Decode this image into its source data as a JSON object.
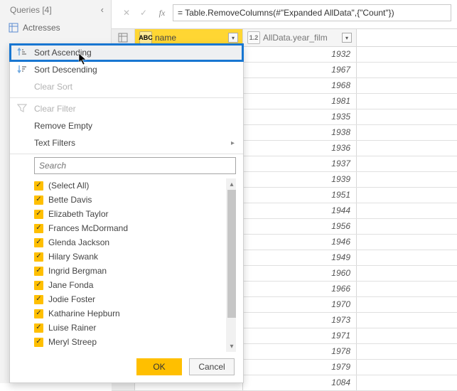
{
  "queries_panel": {
    "title": "Queries [4]",
    "item": "Actresses"
  },
  "formula_bar": {
    "value": "= Table.RemoveColumns(#\"Expanded AllData\",{\"Count\"})"
  },
  "columns": {
    "name_type": "ABC",
    "name_label": "name",
    "year_type": "1.2",
    "year_label": "AllData.year_film"
  },
  "dropdown": {
    "sort_asc": "Sort Ascending",
    "sort_desc": "Sort Descending",
    "clear_sort": "Clear Sort",
    "clear_filter": "Clear Filter",
    "remove_empty": "Remove Empty",
    "text_filters": "Text Filters",
    "search_placeholder": "Search",
    "items": [
      "(Select All)",
      "Bette Davis",
      "Elizabeth Taylor",
      "Frances McDormand",
      "Glenda Jackson",
      "Hilary Swank",
      "Ingrid Bergman",
      "Jane Fonda",
      "Jodie Foster",
      "Katharine Hepburn",
      "Luise Rainer",
      "Meryl Streep"
    ],
    "ok": "OK",
    "cancel": "Cancel"
  },
  "year_values": [
    "1932",
    "1967",
    "1968",
    "1981",
    "1935",
    "1938",
    "1936",
    "1937",
    "1939",
    "1951",
    "1944",
    "1956",
    "1946",
    "1949",
    "1960",
    "1966",
    "1970",
    "1973",
    "1971",
    "1978",
    "1979",
    "1084"
  ]
}
